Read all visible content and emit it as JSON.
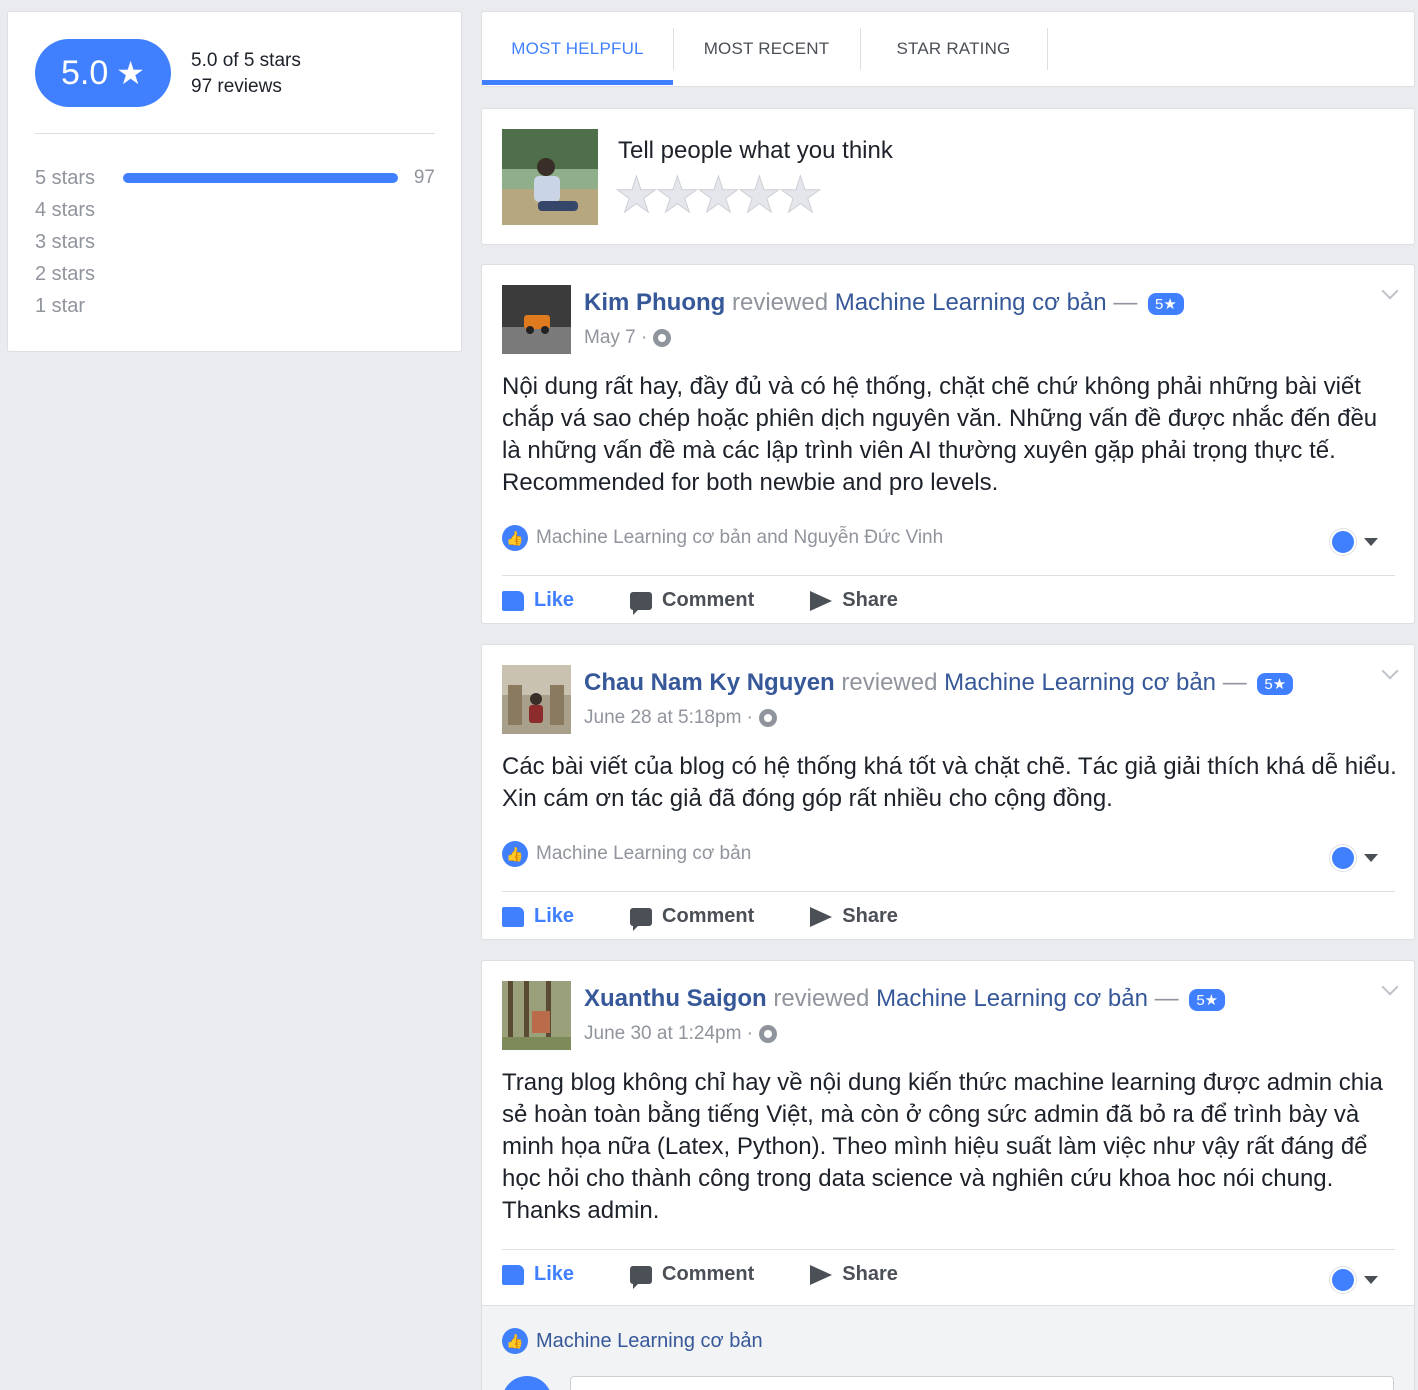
{
  "summary": {
    "score": "5.0",
    "score_star": "★",
    "of_stars": "5.0 of 5 stars",
    "review_count": "97 reviews",
    "distribution": [
      {
        "label": "5 stars",
        "count": "97",
        "fraction": 1.0
      },
      {
        "label": "4 stars",
        "count": "",
        "fraction": 0
      },
      {
        "label": "3 stars",
        "count": "",
        "fraction": 0
      },
      {
        "label": "2 stars",
        "count": "",
        "fraction": 0
      },
      {
        "label": "1 star",
        "count": "",
        "fraction": 0
      }
    ]
  },
  "tabs": [
    {
      "label": "MOST HELPFUL",
      "active": true
    },
    {
      "label": "MOST RECENT",
      "active": false
    },
    {
      "label": "STAR RATING",
      "active": false
    }
  ],
  "compose": {
    "prompt": "Tell people what you think",
    "stars": [
      "★",
      "★",
      "★",
      "★",
      "★"
    ]
  },
  "reviews": [
    {
      "name": "Kim Phuong",
      "verb": "reviewed",
      "page": "Machine Learning cơ bản",
      "dash": "—",
      "badge": "5★",
      "date": "May 7 ·",
      "body": "Nội dung rất hay, đầy đủ và có hệ thống, chặt chẽ chứ không phải những bài viết chắp vá sao chép hoặc phiên dịch nguyên văn. Những vấn đề được nhắc đến đều là những vấn đề mà các lập trình viên AI thường xuyên gặp phải trọng thực tế. Recommended for both newbie and pro levels.",
      "likes_text": "Machine Learning cơ bản and Nguyễn Đức Vinh"
    },
    {
      "name": "Chau Nam Ky Nguyen",
      "verb": "reviewed",
      "page": "Machine Learning cơ bản",
      "dash": "—",
      "badge": "5★",
      "date": "June 28 at 5:18pm ·",
      "body": "Các bài viết của blog có hệ thống khá tốt và chặt chẽ. Tác giả giải thích khá dễ hiểu. Xin cám ơn tác giả đã đóng góp rất nhiều cho cộng đồng.",
      "likes_text": "Machine Learning cơ bản"
    },
    {
      "name": "Xuanthu Saigon",
      "verb": "reviewed",
      "page": "Machine Learning cơ bản",
      "dash": "—",
      "badge": "5★",
      "date": "June 30 at 1:24pm ·",
      "body": "Trang blog không chỉ hay về nội dung kiến thức machine learning được admin chia sẻ hoàn toàn bằng tiếng Việt, mà còn ở công sức admin đã bỏ ra để trình bày và minh họa nữa (Latex, Python). Theo mình hiệu suất làm việc như vậy rất đáng để học hỏi cho thành công trong data science và nghiên cứu khoa hoc nói chung. Thanks admin.",
      "likes_text": "Machine Learning cơ bản"
    }
  ],
  "actions": {
    "like": "Like",
    "comment": "Comment",
    "share": "Share"
  },
  "colors": {
    "accent": "#4080ff",
    "link": "#365899",
    "muted": "#90949c"
  }
}
